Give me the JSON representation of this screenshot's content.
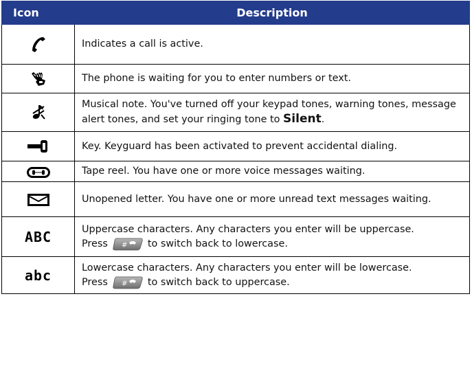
{
  "header": {
    "icon_col": "Icon",
    "desc_col": "Description"
  },
  "rows": [
    {
      "icon": "phone-handset-icon",
      "desc": "Indicates a call is active."
    },
    {
      "icon": "hand-pen-icon",
      "desc": "The phone is waiting for you to enter numbers or text."
    },
    {
      "icon": "musical-note-crossed-icon",
      "desc_pre": "Musical note. You've turned off your keypad tones, warning tones, message alert tones, and set your ringing tone to ",
      "desc_strong": "Silent",
      "desc_post": "."
    },
    {
      "icon": "key-icon",
      "desc": "Key. Keyguard has been activated to prevent accidental dialing."
    },
    {
      "icon": "tape-reel-icon",
      "desc": "Tape reel. You have one or more voice messages waiting."
    },
    {
      "icon": "unopened-letter-icon",
      "desc": "Unopened letter. You have one or more unread text messages waiting."
    },
    {
      "icon": "uppercase-abc-icon",
      "icon_text": "ABC",
      "desc_line1": "Uppercase characters. Any characters you enter will be uppercase.",
      "desc_press": "Press",
      "key_label": "#",
      "desc_after": "to switch back to lowercase."
    },
    {
      "icon": "lowercase-abc-icon",
      "icon_text": "abc",
      "desc_line1": "Lowercase characters. Any characters you enter will be lowercase.",
      "desc_press": "Press",
      "key_label": "#",
      "desc_after": "to switch back to uppercase."
    }
  ]
}
